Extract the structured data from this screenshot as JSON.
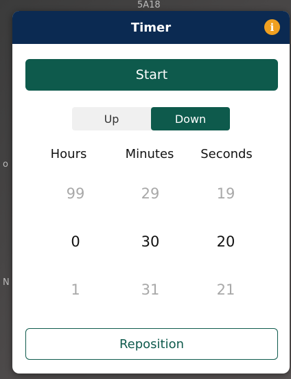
{
  "background": {
    "top_text": "5A18",
    "left_text_1": "o",
    "left_text_2": "N"
  },
  "dialog": {
    "title": "Timer",
    "info_icon_glyph": "i",
    "start_label": "Start",
    "direction": {
      "options": [
        "Up",
        "Down"
      ],
      "selected": "Down"
    },
    "columns": [
      "Hours",
      "Minutes",
      "Seconds"
    ],
    "picker": {
      "hours": {
        "prev": "99",
        "current": "0",
        "next": "1"
      },
      "minutes": {
        "prev": "29",
        "current": "30",
        "next": "31"
      },
      "seconds": {
        "prev": "19",
        "current": "20",
        "next": "21"
      }
    },
    "reposition_label": "Reposition"
  },
  "colors": {
    "accent": "#0e5a4c",
    "titlebar": "#0b2a52",
    "info": "#f0a020"
  }
}
